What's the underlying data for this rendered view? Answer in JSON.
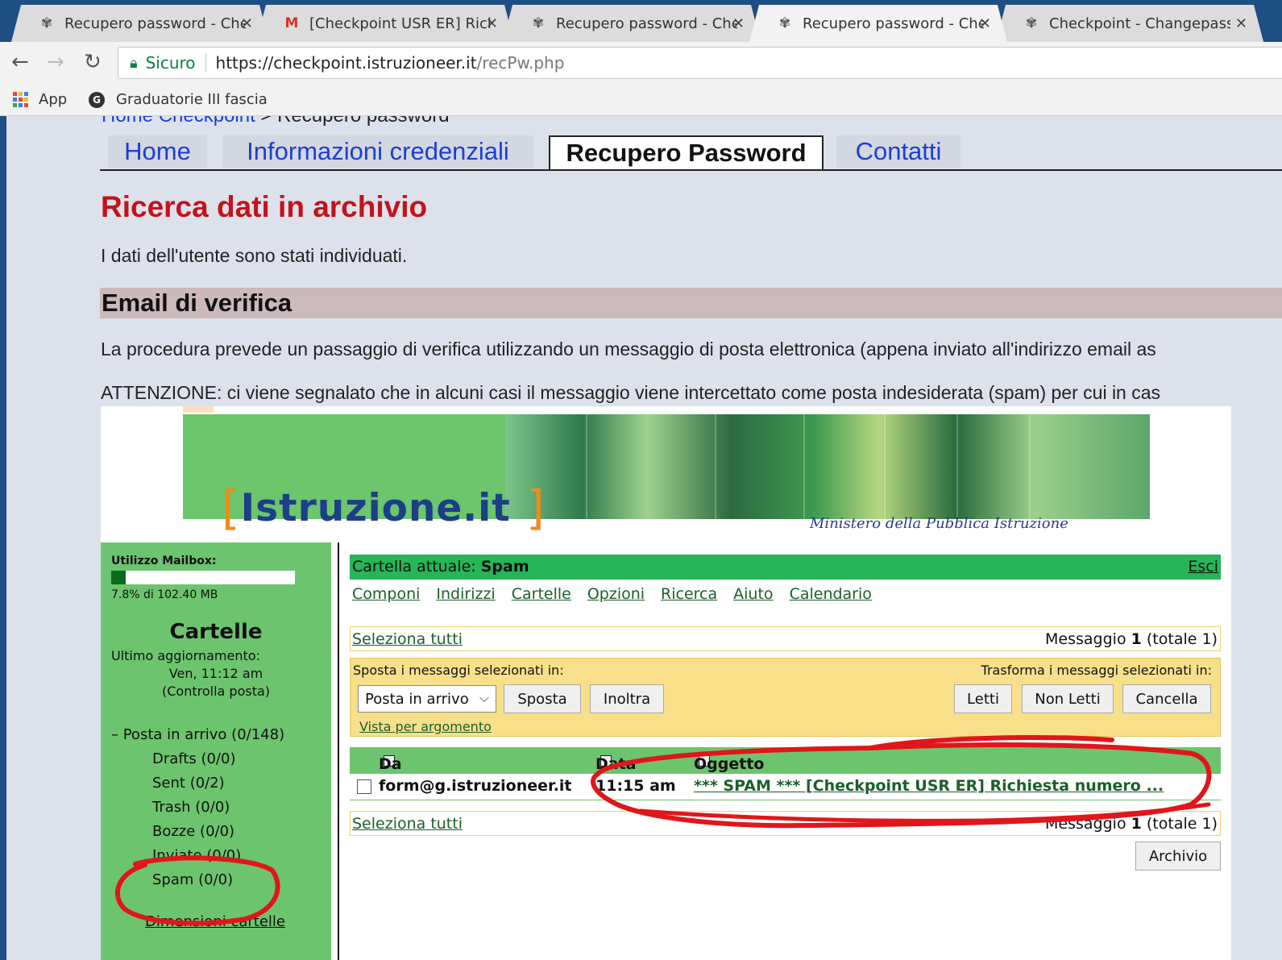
{
  "browser": {
    "tabs": [
      {
        "label": "Recupero password - Che",
        "icon": "usr-favicon",
        "active": false
      },
      {
        "label": "[Checkpoint USR ER] Rich",
        "icon": "gmail-icon",
        "active": false
      },
      {
        "label": "Recupero password - Che",
        "icon": "usr-favicon",
        "active": false
      },
      {
        "label": "Recupero password - Che",
        "icon": "usr-favicon",
        "active": true
      },
      {
        "label": "Checkpoint - Changepass",
        "icon": "usr-favicon",
        "active": false
      }
    ],
    "secure_label": "Sicuro",
    "url_host": "https://checkpoint.istruzioneer.it",
    "url_path": "/recPw.php",
    "bookmarks": {
      "apps": "App",
      "graduatorie": "Graduatorie III fascia"
    }
  },
  "page": {
    "breadcrumb_home": "Home Checkpoint",
    "breadcrumb_rest": " > Recupero password",
    "nav": [
      "Home",
      "Informazioni credenziali",
      "Recupero Password",
      "Contatti"
    ],
    "heading": "Ricerca dati in archivio",
    "found_text": "I dati dell'utente sono stati individuati.",
    "section_title": "Email di verifica",
    "procedure_text": "La procedura prevede un passaggio di verifica utilizzando un messaggio di posta elettronica (appena inviato all'indirizzo email as",
    "warning_text": "ATTENZIONE: ci viene segnalato che in alcuni casi il messaggio viene intercettato come posta indesiderata (spam) per cui in cas"
  },
  "mail": {
    "brand": "Istruzione.it",
    "ministero": "Ministero della Pubblica Istruzione",
    "sidebar": {
      "usage_label": "Utilizzo Mailbox:",
      "usage_fraction": 0.078,
      "usage_value": "7.8% di 102.40 MB",
      "title": "Cartelle",
      "updated_label": "Ultimo aggiornamento:",
      "updated_time": "Ven, 11:12 am",
      "check_mail": "Controlla posta",
      "folders": [
        "– Posta in arrivo (0/148)",
        "Drafts (0/0)",
        "Sent (0/2)",
        "Trash (0/0)",
        "Bozze (0/0)",
        "Inviate (0/0)",
        "Spam (0/0)"
      ],
      "folder_sizes": "Dimensioni cartelle"
    },
    "current_folder_label": "Cartella attuale: ",
    "current_folder": "Spam",
    "logout": "Esci",
    "menu": [
      "Componi",
      "Indirizzi",
      "Cartelle",
      "Opzioni",
      "Ricerca",
      "Aiuto",
      "Calendario"
    ],
    "select_all": "Seleziona tutti",
    "message_count_prefix": "Messaggio ",
    "message_count_num": "1",
    "message_count_suffix": " (totale 1)",
    "move_label": "Sposta i messaggi selezionati in:",
    "transform_label": "Trasforma i messaggi selezionati in:",
    "move_target": "Posta in arrivo",
    "buttons": {
      "move": "Sposta",
      "forward": "Inoltra",
      "read": "Letti",
      "unread": "Non Letti",
      "delete": "Cancella",
      "archive": "Archivio"
    },
    "thread_view": "Vista per argomento",
    "columns": {
      "from": "Da",
      "date": "Data",
      "subject": "Oggetto"
    },
    "message": {
      "from": "form@g.istruzioneer.it",
      "time": "11:15 am",
      "subject": "*** SPAM *** [Checkpoint USR ER] Richiesta numero ..."
    }
  },
  "colors": {
    "annotation": "#e0161b",
    "heading_red": "#c4121a",
    "mail_green": "#6dc46f"
  }
}
